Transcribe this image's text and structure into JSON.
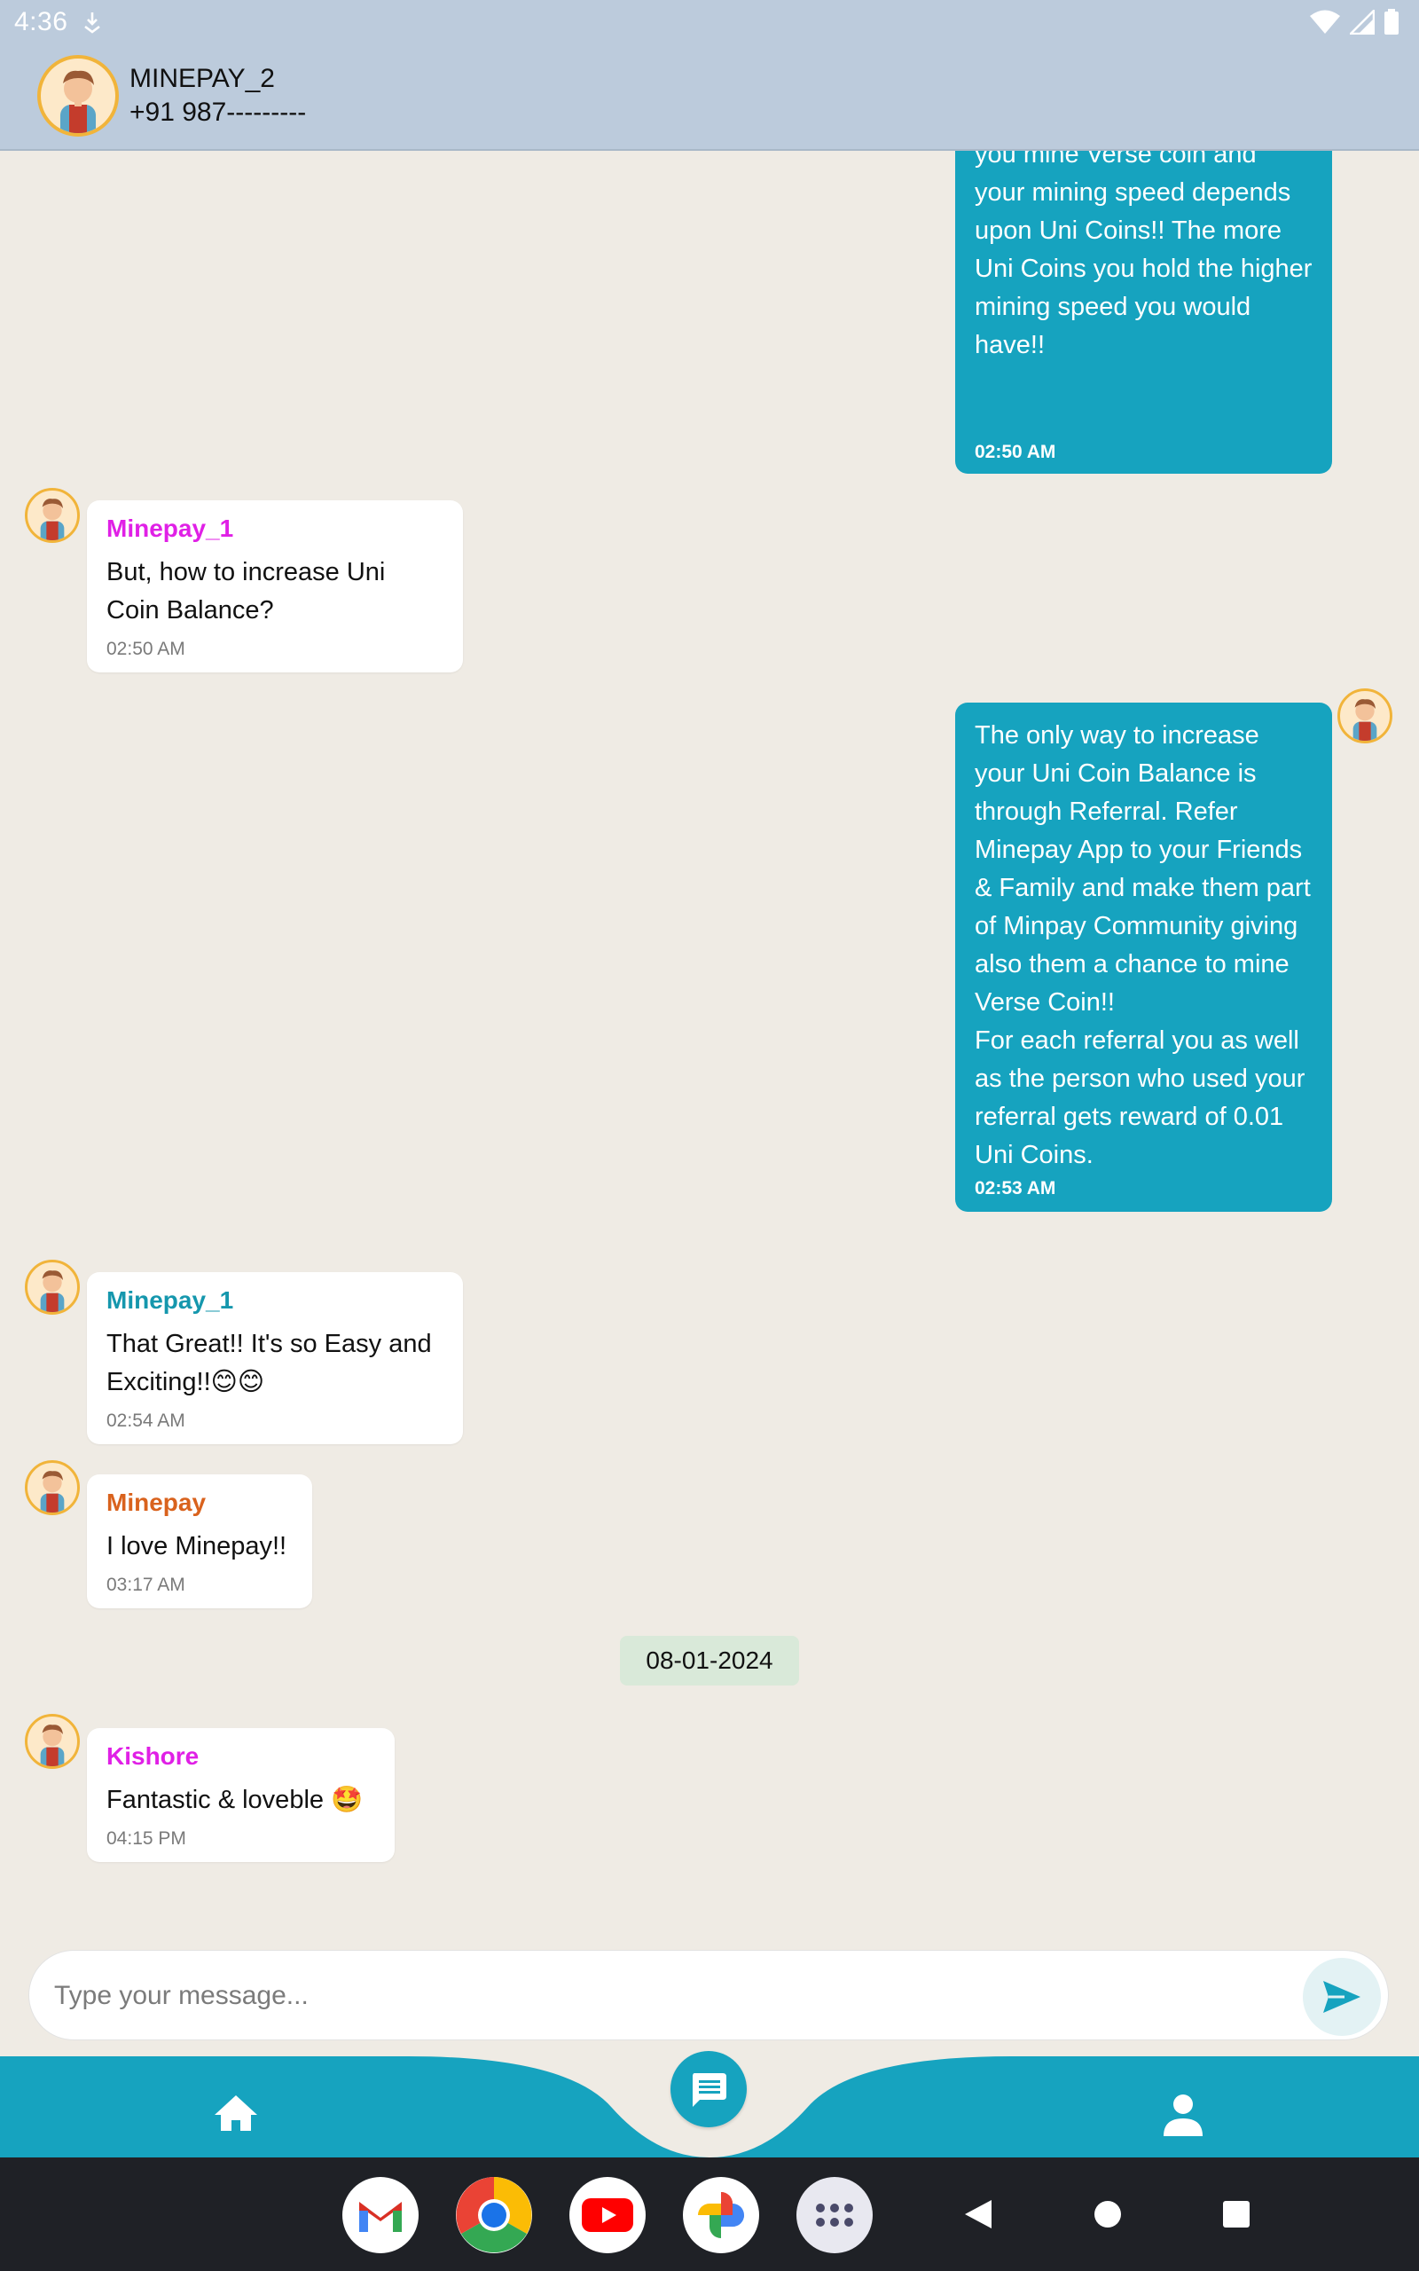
{
  "status_bar": {
    "time": "4:36"
  },
  "header": {
    "name": "MINEPAY_2",
    "phone": "+91 987---------"
  },
  "messages": [
    {
      "direction": "out",
      "text": "The Process is very simple you mine Verse coin and your mining speed depends upon Uni Coins!! The more Uni Coins you hold the higher mining speed you would have!!",
      "time": "02:50 AM"
    },
    {
      "direction": "in",
      "sender": "Minepay_1",
      "sender_color": "#e020e6",
      "text": "But, how to increase Uni Coin Balance?",
      "time": "02:50 AM"
    },
    {
      "direction": "out",
      "text": "The only way to increase your Uni Coin Balance is through Referral. Refer Minepay App to your Friends & Family and make them part of Minpay Community giving also them a chance to mine Verse Coin!!\nFor each referral you as well as the person who used your referral gets reward of 0.01 Uni Coins.",
      "time": "02:53 AM"
    },
    {
      "direction": "in",
      "sender": "Minepay_1",
      "sender_color": "#1597ad",
      "text": "That Great!! It's so Easy and Exciting!!😊😊",
      "time": "02:54 AM"
    },
    {
      "direction": "in",
      "sender": "Minepay",
      "sender_color": "#d9621d",
      "text": "I love Minepay!!",
      "time": "03:17 AM"
    },
    {
      "direction": "in",
      "sender": "Kishore",
      "sender_color": "#e020e6",
      "text": "Fantastic & loveble 🤩",
      "time": "04:15 PM"
    }
  ],
  "date_separator": "08-01-2024",
  "composer": {
    "placeholder": "Type your message..."
  },
  "bottom_nav": {
    "items": [
      "home-icon",
      "chat-icon",
      "person-icon"
    ],
    "active": "chat-icon",
    "accent": "#16a3bf"
  },
  "dock": {
    "apps": [
      "gmail-icon",
      "chrome-icon",
      "youtube-icon",
      "photos-icon",
      "app-drawer-icon"
    ]
  }
}
